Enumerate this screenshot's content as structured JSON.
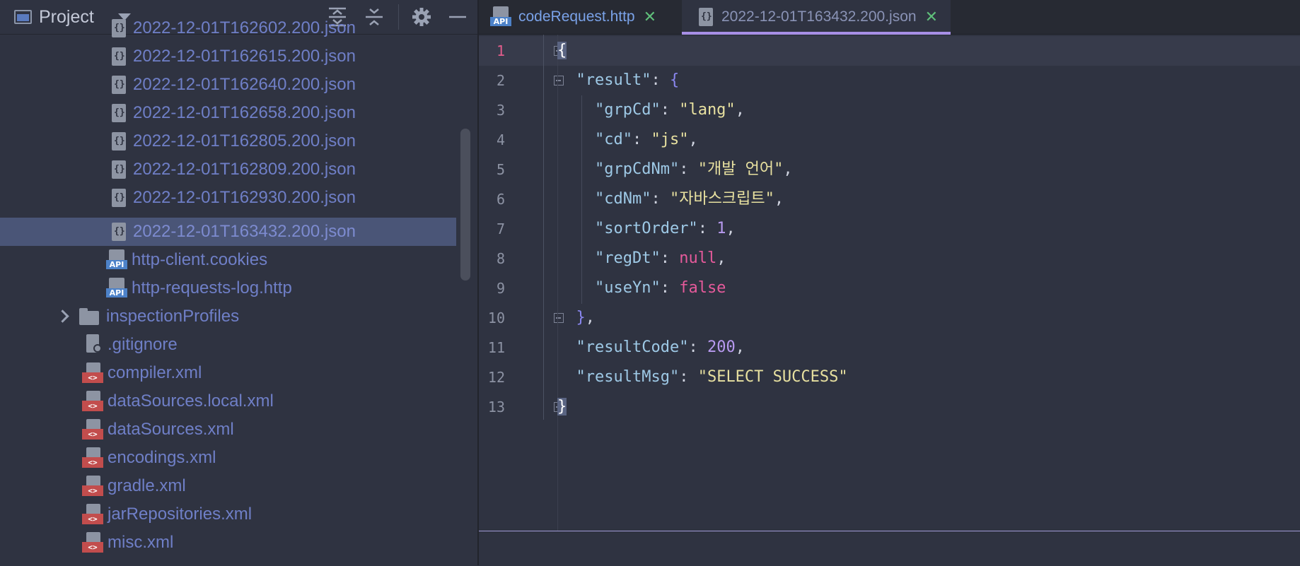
{
  "project_panel": {
    "title": "Project",
    "tree": [
      {
        "label": "2022-12-01T162602.200.json",
        "icon": "json-file-icon",
        "selected": false
      },
      {
        "label": "2022-12-01T162615.200.json",
        "icon": "json-file-icon",
        "selected": false
      },
      {
        "label": "2022-12-01T162640.200.json",
        "icon": "json-file-icon",
        "selected": false
      },
      {
        "label": "2022-12-01T162658.200.json",
        "icon": "json-file-icon",
        "selected": false
      },
      {
        "label": "2022-12-01T162805.200.json",
        "icon": "json-file-icon",
        "selected": false
      },
      {
        "label": "2022-12-01T162809.200.json",
        "icon": "json-file-icon",
        "selected": false
      },
      {
        "label": "2022-12-01T162930.200.json",
        "icon": "json-file-icon",
        "selected": false
      },
      {
        "label": "2022-12-01T163432.200.json",
        "icon": "json-file-icon",
        "selected": true
      },
      {
        "label": "http-client.cookies",
        "icon": "api-file-icon",
        "selected": false
      },
      {
        "label": "http-requests-log.http",
        "icon": "api-file-icon",
        "selected": false
      },
      {
        "label": "inspectionProfiles",
        "icon": "folder-icon",
        "selected": false
      },
      {
        "label": ".gitignore",
        "icon": "ignore-file-icon",
        "selected": false
      },
      {
        "label": "compiler.xml",
        "icon": "xml-file-icon",
        "selected": false
      },
      {
        "label": "dataSources.local.xml",
        "icon": "xml-file-icon",
        "selected": false
      },
      {
        "label": "dataSources.xml",
        "icon": "xml-file-icon",
        "selected": false
      },
      {
        "label": "encodings.xml",
        "icon": "xml-file-icon",
        "selected": false
      },
      {
        "label": "gradle.xml",
        "icon": "xml-file-icon",
        "selected": false
      },
      {
        "label": "jarRepositories.xml",
        "icon": "xml-file-icon",
        "selected": false
      },
      {
        "label": "misc.xml",
        "icon": "xml-file-icon",
        "selected": false
      }
    ]
  },
  "tabs": [
    {
      "label": "codeRequest.http",
      "icon": "api-file-icon",
      "active": false
    },
    {
      "label": "2022-12-01T163432.200.json",
      "icon": "json-file-icon",
      "active": true
    }
  ],
  "editor": {
    "line_numbers": [
      "1",
      "2",
      "3",
      "4",
      "5",
      "6",
      "7",
      "8",
      "9",
      "10",
      "11",
      "12",
      "13"
    ],
    "current_line": "1",
    "lines": {
      "l1": {
        "brace": "{"
      },
      "l2": {
        "key": "\"result\"",
        "colon": ": ",
        "brace": "{"
      },
      "l3": {
        "key": "\"grpCd\"",
        "colon": ": ",
        "value": "\"lang\"",
        "comma": ","
      },
      "l4": {
        "key": "\"cd\"",
        "colon": ": ",
        "value": "\"js\"",
        "comma": ","
      },
      "l5": {
        "key": "\"grpCdNm\"",
        "colon": ": ",
        "value": "\"개발 언어\"",
        "comma": ","
      },
      "l6": {
        "key": "\"cdNm\"",
        "colon": ": ",
        "value": "\"자바스크립트\"",
        "comma": ","
      },
      "l7": {
        "key": "\"sortOrder\"",
        "colon": ": ",
        "value": "1",
        "comma": ","
      },
      "l8": {
        "key": "\"regDt\"",
        "colon": ": ",
        "value": "null",
        "comma": ","
      },
      "l9": {
        "key": "\"useYn\"",
        "colon": ": ",
        "value": "false"
      },
      "l10": {
        "brace": "}",
        "comma": ","
      },
      "l11": {
        "key": "\"resultCode\"",
        "colon": ": ",
        "value": "200",
        "comma": ","
      },
      "l12": {
        "key": "\"resultMsg\"",
        "colon": ": ",
        "value": "\"SELECT SUCCESS\""
      },
      "l13": {
        "brace": "}"
      }
    }
  },
  "colors": {
    "background": "#2f3341",
    "selection": "#4a5577",
    "tab_underline": "#a78fe6",
    "json_key": "#9ec9e6",
    "json_string": "#e8e1a0",
    "json_number": "#b89af0",
    "json_keyword": "#e65a9b"
  }
}
